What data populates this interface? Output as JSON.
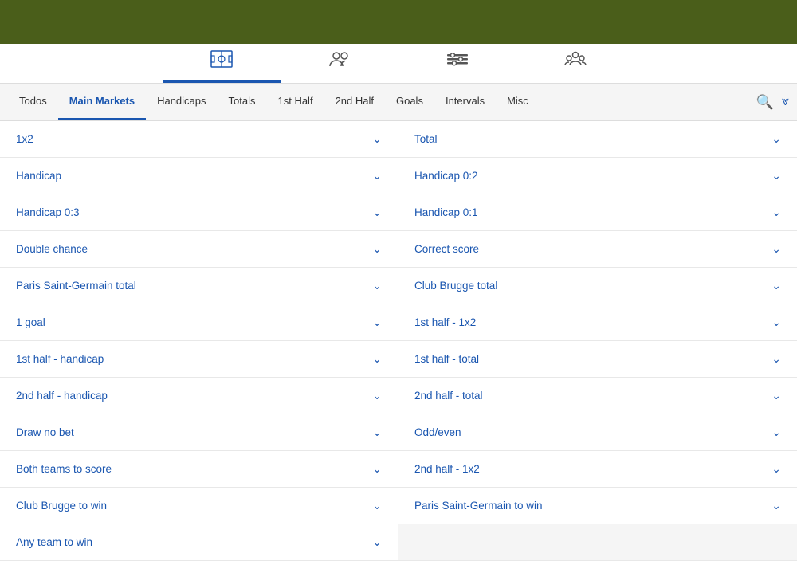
{
  "topBar": {
    "bgColor": "#4a5e1a"
  },
  "tabIcons": [
    {
      "id": "tab-field",
      "icon": "⊞",
      "label": "Field",
      "active": true
    },
    {
      "id": "tab-players",
      "icon": "👥",
      "label": "Players",
      "active": false
    },
    {
      "id": "tab-settings",
      "icon": "⚙",
      "label": "Settings",
      "active": false
    },
    {
      "id": "tab-groups",
      "icon": "👥",
      "label": "Groups",
      "active": false
    }
  ],
  "navTabs": [
    {
      "id": "todos",
      "label": "Todos",
      "active": false
    },
    {
      "id": "main-markets",
      "label": "Main Markets",
      "active": true
    },
    {
      "id": "handicaps",
      "label": "Handicaps",
      "active": false
    },
    {
      "id": "totals",
      "label": "Totals",
      "active": false
    },
    {
      "id": "1st-half",
      "label": "1st Half",
      "active": false
    },
    {
      "id": "2nd-half",
      "label": "2nd Half",
      "active": false
    },
    {
      "id": "goals",
      "label": "Goals",
      "active": false
    },
    {
      "id": "intervals",
      "label": "Intervals",
      "active": false
    },
    {
      "id": "misc",
      "label": "Misc",
      "active": false
    }
  ],
  "navRight": {
    "searchLabel": "🔍",
    "filterLabel": "⩔"
  },
  "markets": [
    {
      "left": "1x2",
      "right": "Total"
    },
    {
      "left": "Handicap",
      "right": "Handicap 0:2"
    },
    {
      "left": "Handicap 0:3",
      "right": "Handicap 0:1"
    },
    {
      "left": "Double chance",
      "right": "Correct score"
    },
    {
      "left": "Paris Saint-Germain total",
      "right": "Club Brugge total"
    },
    {
      "left": "1 goal",
      "right": "1st half - 1x2"
    },
    {
      "left": "1st half - handicap",
      "right": "1st half - total"
    },
    {
      "left": "2nd half - handicap",
      "right": "2nd half - total"
    },
    {
      "left": "Draw no bet",
      "right": "Odd/even"
    },
    {
      "left": "Both teams to score",
      "right": "2nd half - 1x2"
    },
    {
      "left": "Club Brugge to win",
      "right": "Paris Saint-Germain to win"
    },
    {
      "left": "Any team to win",
      "right": null
    }
  ]
}
